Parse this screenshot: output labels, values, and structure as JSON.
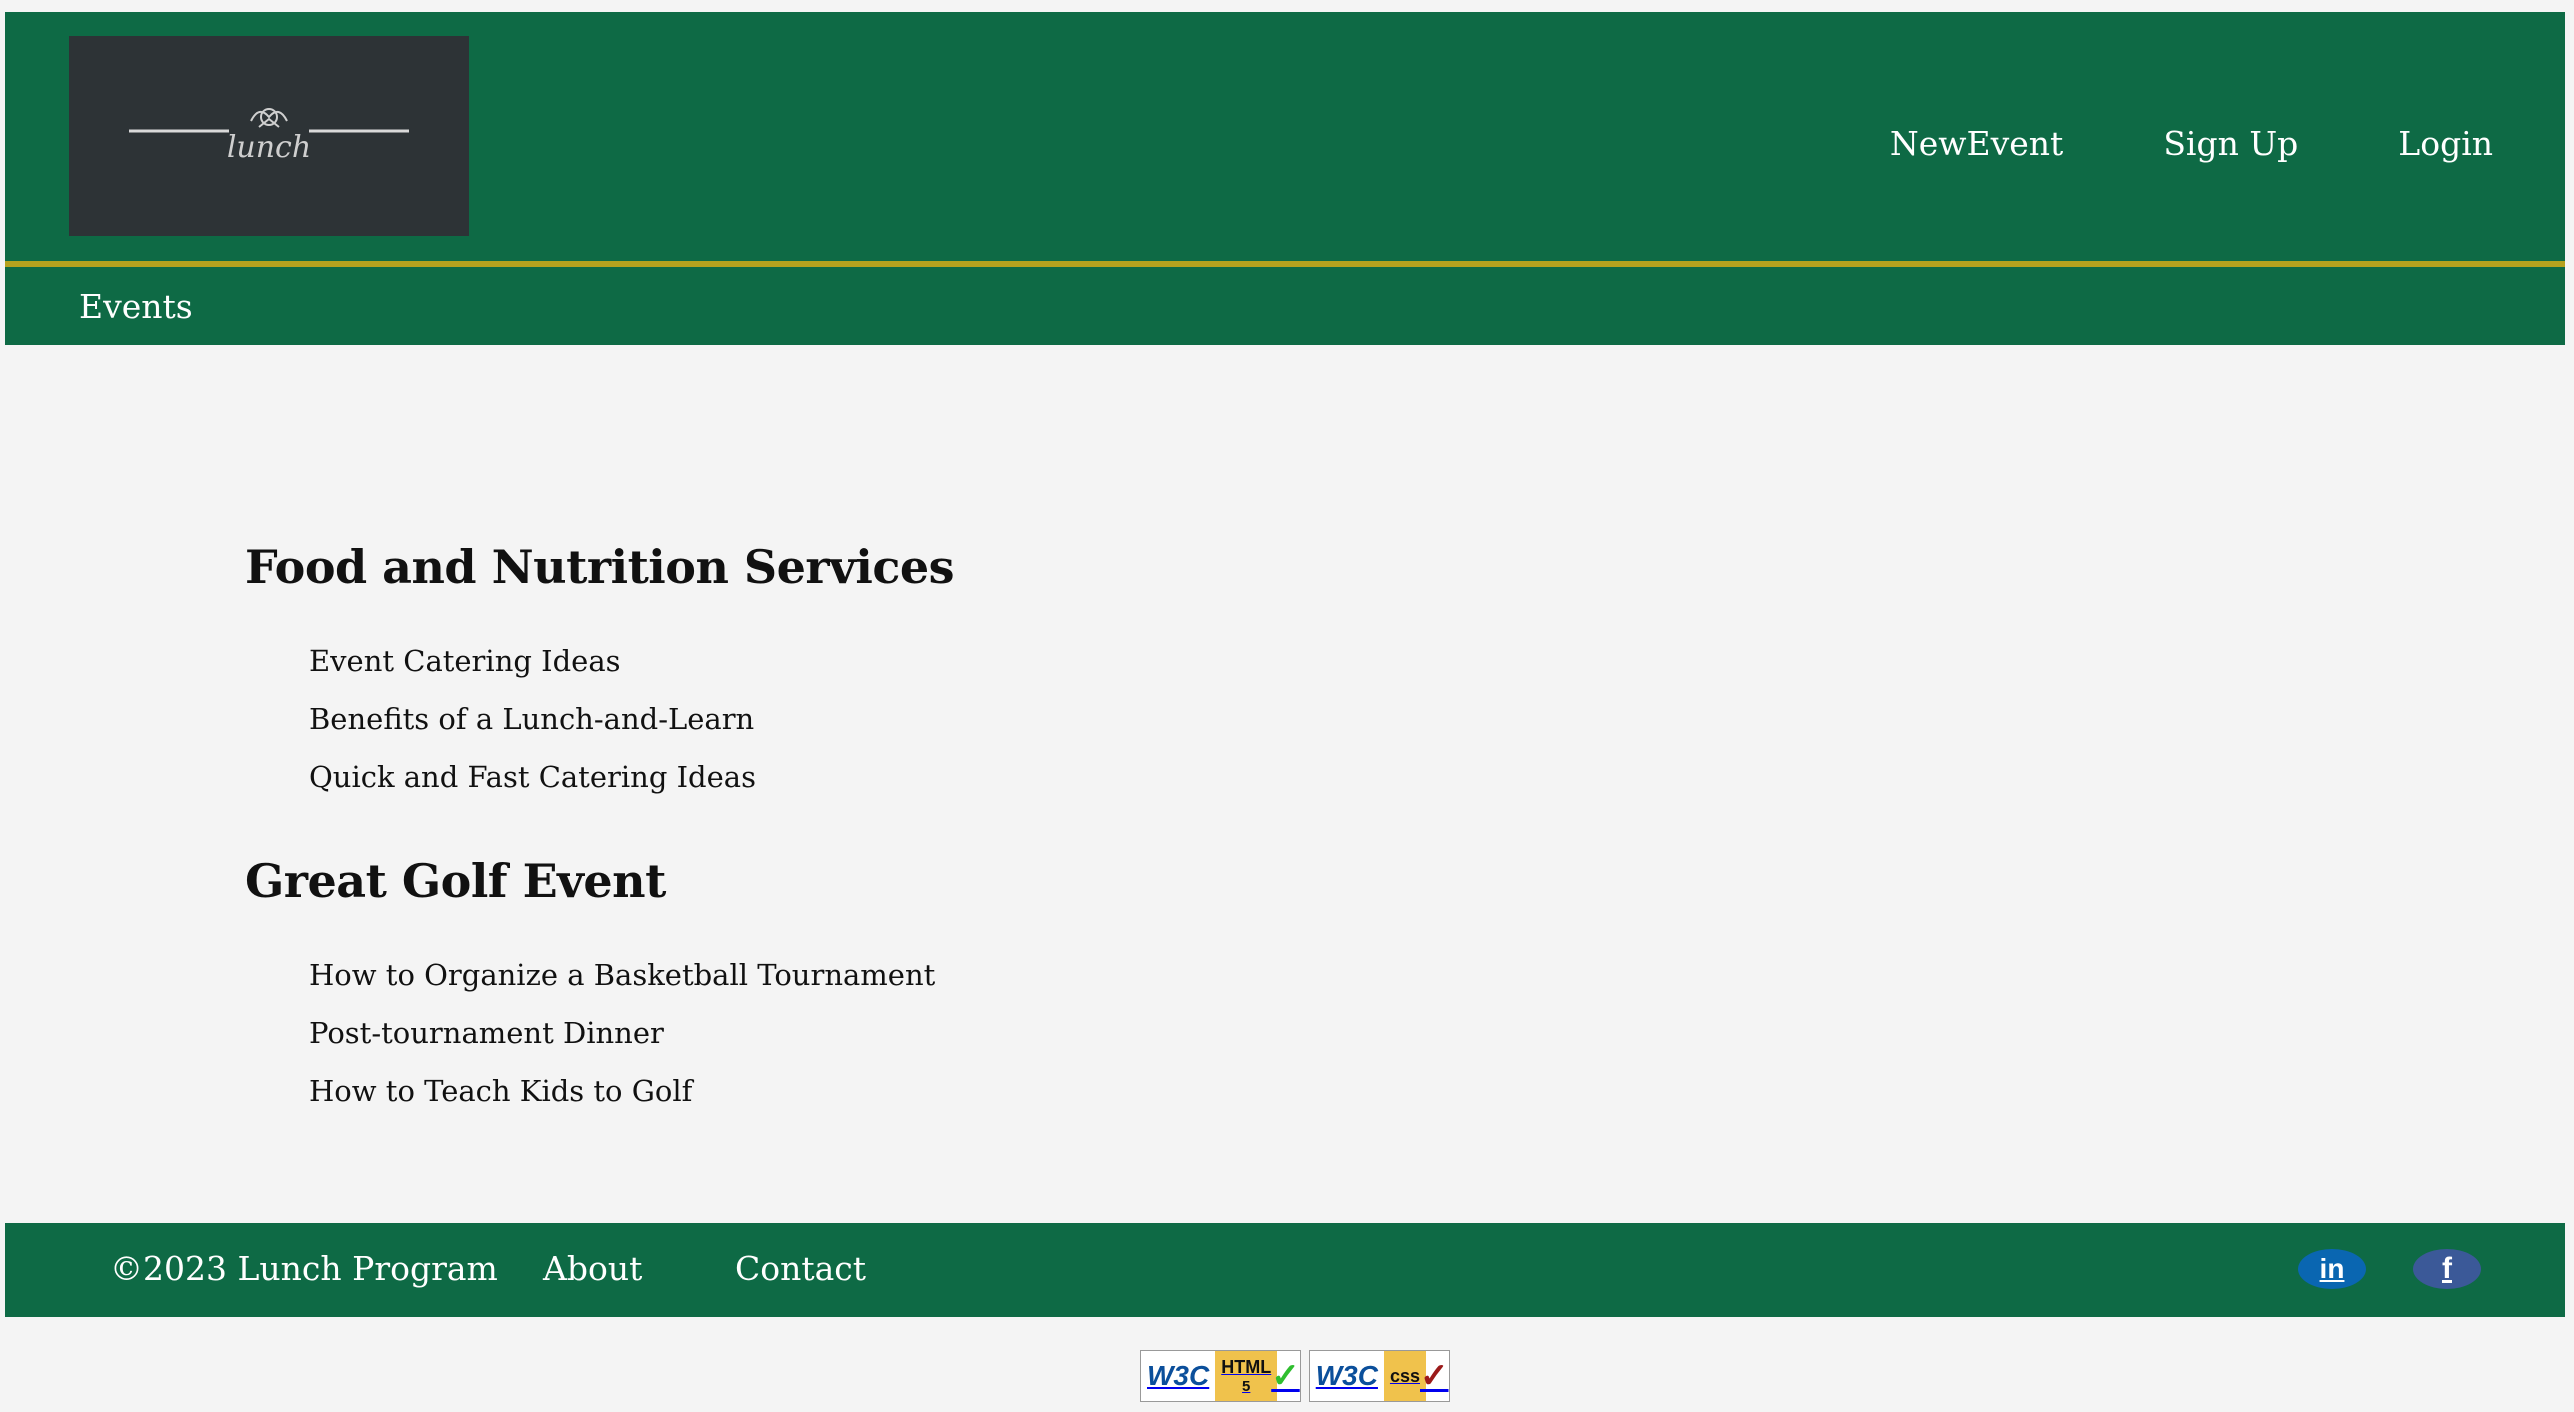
{
  "header": {
    "logo_text": "lunch",
    "nav": [
      "NewEvent",
      "Sign Up",
      "Login"
    ]
  },
  "subnav": {
    "events_label": "Events"
  },
  "sections": [
    {
      "title": "Food and Nutrition Services",
      "links": [
        "Event Catering Ideas",
        "Benefits of a Lunch-and-Learn",
        "Quick and Fast Catering Ideas"
      ]
    },
    {
      "title": "Great Golf Event",
      "links": [
        "How to Organize a Basketball Tournament",
        "Post-tournament Dinner",
        "How to Teach Kids to Golf"
      ]
    }
  ],
  "footer": {
    "copyright": "©2023 Lunch Program",
    "about": "About",
    "contact": "Contact",
    "linkedin_label": "in",
    "facebook_label": "f"
  },
  "badges": {
    "html": {
      "w3c": "W3C",
      "tag": "HTML",
      "version": "5"
    },
    "css": {
      "w3c": "W3C",
      "tag": "css"
    }
  },
  "colors": {
    "header_bg": "#0e6a45",
    "accent_rule": "#b5a21e",
    "logo_bg": "#2d3336",
    "linkedin": "#0a66b1",
    "facebook": "#3b5998"
  }
}
